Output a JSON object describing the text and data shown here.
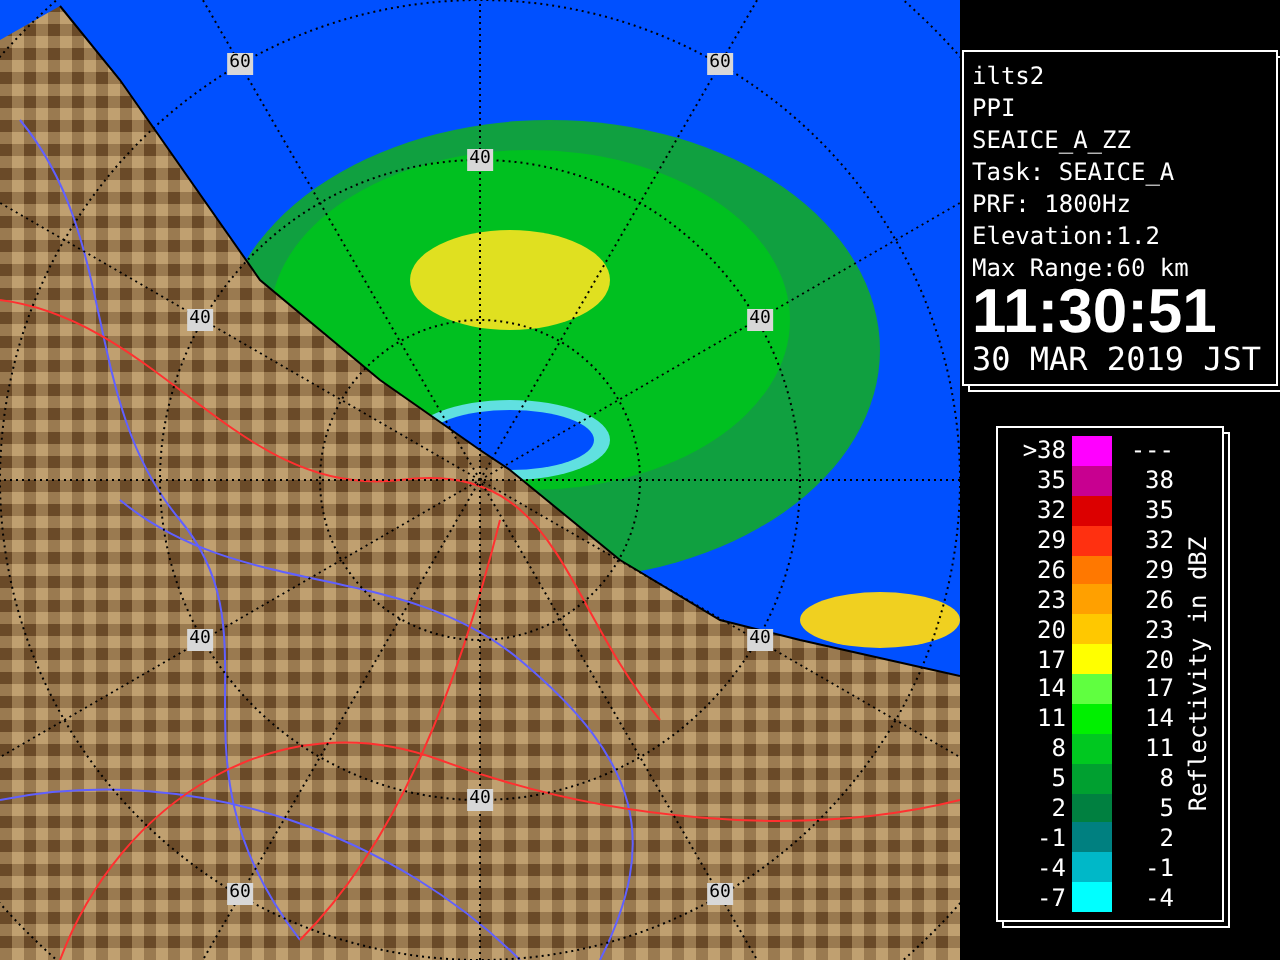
{
  "map": {
    "range_labels": [
      "60",
      "60",
      "40",
      "40",
      "40",
      "40",
      "40",
      "40",
      "60",
      "60"
    ]
  },
  "info_panel": {
    "lines": [
      "ilts2",
      "PPI",
      "SEAICE_A_ZZ",
      "Task: SEAICE_A",
      "PRF: 1800Hz",
      "Elevation:1.2",
      "Max Range:60 km"
    ],
    "time": "11:30:51",
    "date": "30 MAR 2019 JST"
  },
  "legend": {
    "title": "Reflectivity in dBZ",
    "rows": [
      {
        "low": ">38",
        "high": "---",
        "color": "#ff00ff"
      },
      {
        "low": "35",
        "high": "38",
        "color": "#c80090"
      },
      {
        "low": "32",
        "high": "35",
        "color": "#dc0000"
      },
      {
        "low": "29",
        "high": "32",
        "color": "#ff3010"
      },
      {
        "low": "26",
        "high": "29",
        "color": "#ff7800"
      },
      {
        "low": "23",
        "high": "26",
        "color": "#ffa000"
      },
      {
        "low": "20",
        "high": "23",
        "color": "#ffc800"
      },
      {
        "low": "17",
        "high": "20",
        "color": "#ffff00"
      },
      {
        "low": "14",
        "high": "17",
        "color": "#60ff40"
      },
      {
        "low": "11",
        "high": "14",
        "color": "#00f000"
      },
      {
        "low": "8",
        "high": "11",
        "color": "#00c820"
      },
      {
        "low": "5",
        "high": "8",
        "color": "#00a030"
      },
      {
        "low": "2",
        "high": "5",
        "color": "#008040"
      },
      {
        "low": "-1",
        "high": "2",
        "color": "#008080"
      },
      {
        "low": "-4",
        "high": "-1",
        "color": "#00b8c8"
      },
      {
        "low": "-7",
        "high": "-4",
        "color": "#00ffff"
      }
    ]
  }
}
